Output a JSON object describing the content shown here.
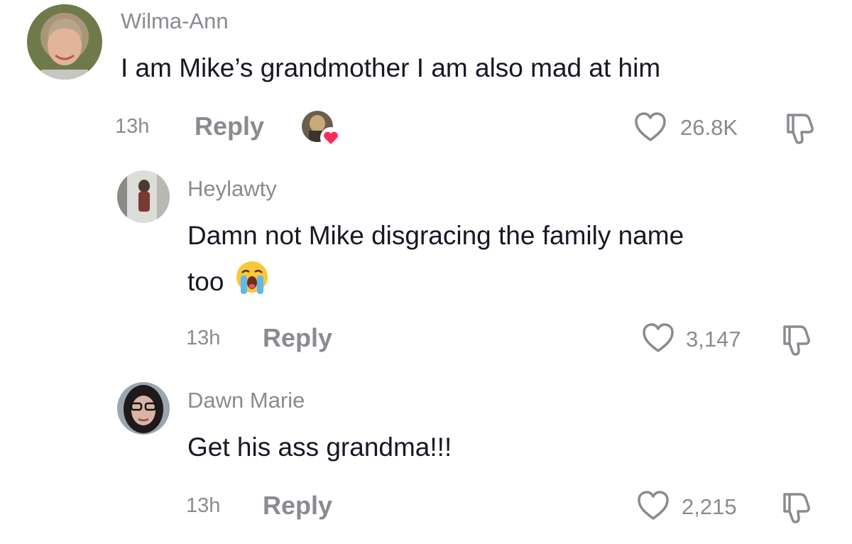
{
  "comments": [
    {
      "username": "Wilma-Ann",
      "text": "I am Mike’s grandmother I am also mad at him",
      "time": "13h",
      "reply_label": "Reply",
      "likes": "26.8K",
      "liked_by_creator": true
    },
    {
      "username": "Heylawty",
      "text_line1": "Damn not Mike disgracing the family name",
      "text_line2": "too",
      "emoji": "loudly-crying-face",
      "time": "13h",
      "reply_label": "Reply",
      "likes": "3,147"
    },
    {
      "username": "Dawn Marie",
      "text": "Get his ass grandma!!!",
      "time": "13h",
      "reply_label": "Reply",
      "likes": "2,215"
    }
  ],
  "colors": {
    "secondary_text": "#8a8b91",
    "primary_text": "#161823",
    "heart_badge": "#fe2c55"
  }
}
